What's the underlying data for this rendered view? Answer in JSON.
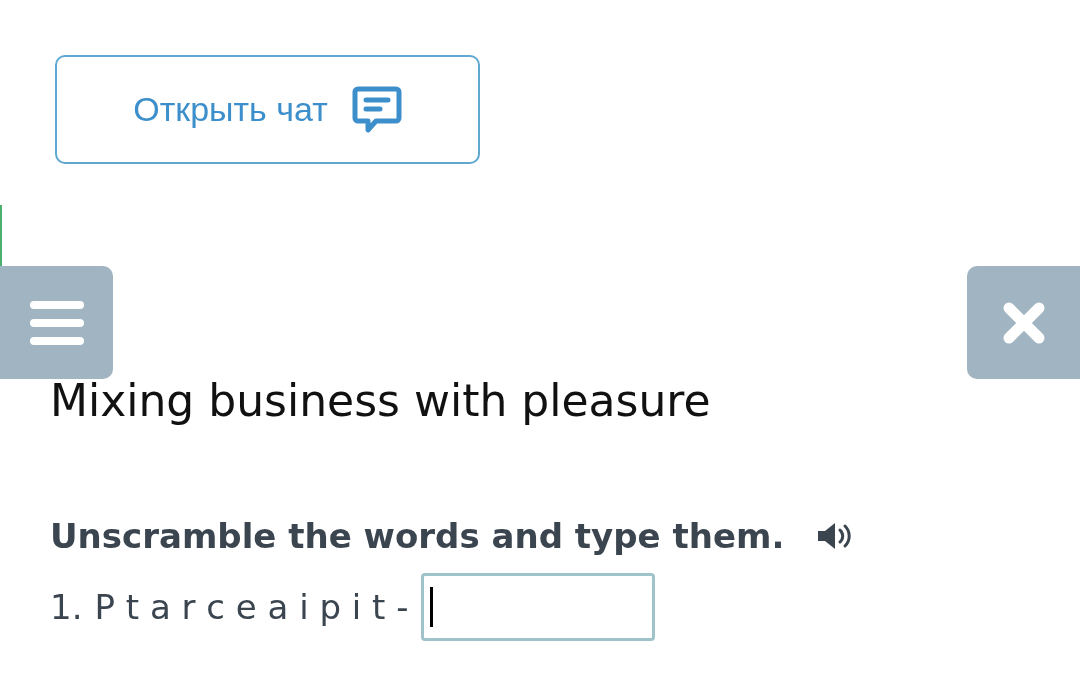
{
  "chat_button": {
    "label": "Открыть чат"
  },
  "title": "Mixing business with pleasure",
  "instruction": "Unscramble the words and type them.",
  "items": [
    {
      "number": "1.",
      "scrambled": "P t a r c e a i p i t -",
      "answer": {
        "focused": true
      }
    }
  ]
}
